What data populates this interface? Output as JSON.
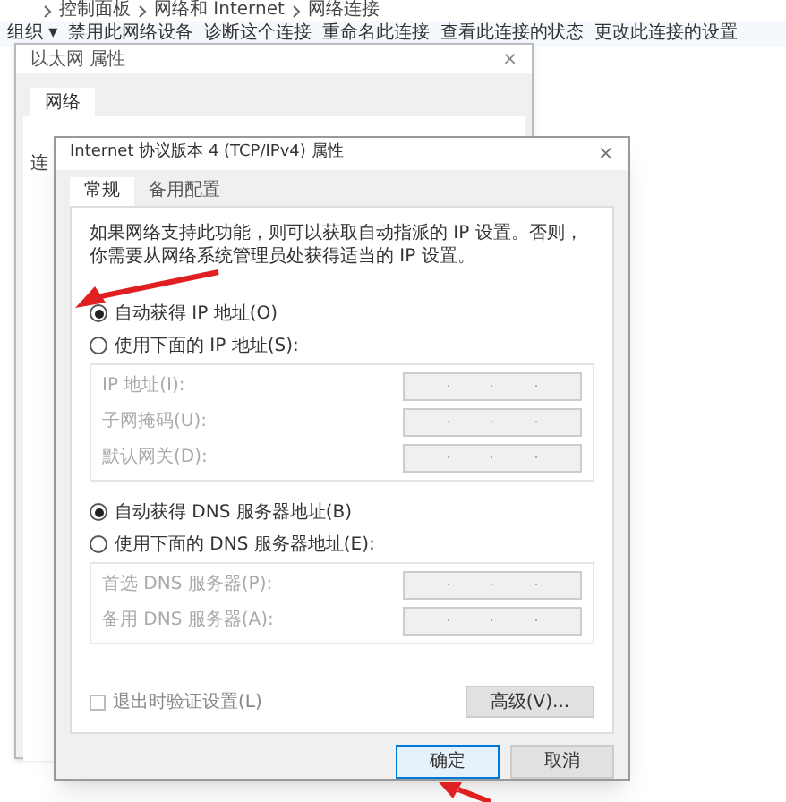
{
  "explorer": {
    "breadcrumb": [
      "控制面板",
      "网络和 Internet",
      "网络连接"
    ],
    "toolbar": [
      "组织 ▾",
      "禁用此网络设备",
      "诊断这个连接",
      "重命名此连接",
      "查看此连接的状态",
      "更改此连接的设置"
    ]
  },
  "ethernet_dialog": {
    "title": "以太网 属性",
    "close": "×",
    "tabs": [
      {
        "label": "网络",
        "selected": true
      }
    ],
    "partial_text": "连"
  },
  "ipv4_dialog": {
    "title": "Internet 协议版本 4 (TCP/IPv4) 属性",
    "close": "×",
    "tabs": [
      {
        "label": "常规",
        "selected": true
      },
      {
        "label": "备用配置",
        "selected": false
      }
    ],
    "description": "如果网络支持此功能，则可以获取自动指派的 IP 设置。否则，你需要从网络系统管理员处获得适当的 IP 设置。",
    "ip_options": [
      {
        "label": "自动获得 IP 地址(O)",
        "selected": true
      },
      {
        "label": "使用下面的 IP 地址(S):",
        "selected": false
      }
    ],
    "ip_fields": [
      {
        "label": "IP 地址(I):",
        "disabled": true
      },
      {
        "label": "子网掩码(U):",
        "disabled": true
      },
      {
        "label": "默认网关(D):",
        "disabled": true
      }
    ],
    "dns_options": [
      {
        "label": "自动获得 DNS 服务器地址(B)",
        "selected": true
      },
      {
        "label": "使用下面的 DNS 服务器地址(E):",
        "selected": false
      }
    ],
    "dns_fields": [
      {
        "label": "首选 DNS 服务器(P):",
        "disabled": true
      },
      {
        "label": "备用 DNS 服务器(A):",
        "disabled": true
      }
    ],
    "validate_on_exit": {
      "label": "退出时验证设置(L)",
      "checked": false,
      "disabled": true
    },
    "advanced_button": "高级(V)...",
    "buttons": [
      "确定",
      "取消"
    ]
  }
}
